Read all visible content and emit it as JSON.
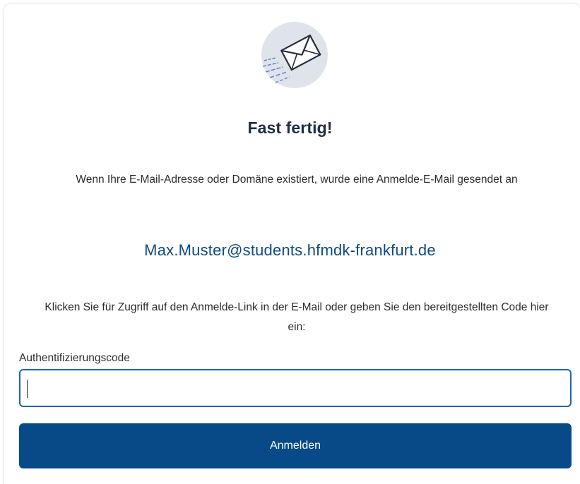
{
  "header": {
    "icon": "envelope-sent-icon",
    "title": "Fast fertig!"
  },
  "message": {
    "text": "Wenn Ihre E-Mail-Adresse oder Domäne existiert, wurde eine Anmelde-E-Mail gesendet an",
    "email": "Max.Muster@students.hfmdk-frankfurt.de",
    "instruction": "Klicken Sie für Zugriff auf den Anmelde-Link in der E-Mail oder geben Sie den bereitgestellten Code hier ein:"
  },
  "form": {
    "code_label": "Authentifizierungscode",
    "code_value": "",
    "submit_label": "Anmelden"
  },
  "colors": {
    "primary_button": "#074a87",
    "input_focus_border": "#1d62b8",
    "email_text": "#0f4a84",
    "title_text": "#1c2f44",
    "icon_circle": "#dfe3ea"
  }
}
